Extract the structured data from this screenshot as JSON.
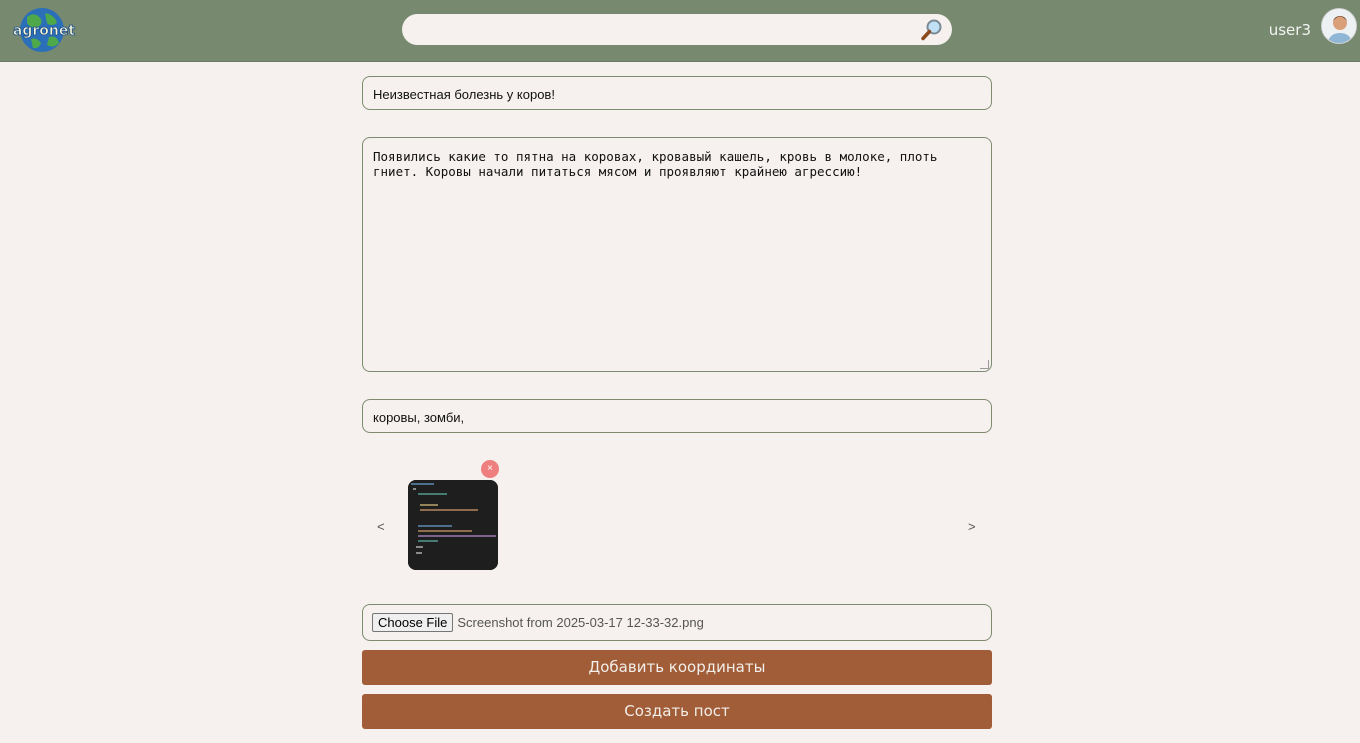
{
  "header": {
    "logo_text": "agronet",
    "search_placeholder": "",
    "username": "user3"
  },
  "form": {
    "title_value": "Неизвестная болезнь у коров!",
    "body_value": "Появились какие то пятна на коровах, кровавый кашель, кровь в молоке, плоть\nгниет. Коровы начали питаться мясом и проявляют крайнею агрессию!",
    "tags_value": "коровы, зомби,",
    "carousel": {
      "prev": "<",
      "next": ">",
      "remove": "×"
    },
    "file": {
      "button_label": "Choose File",
      "file_name": "Screenshot from 2025-03-17 12-33-32.png"
    },
    "add_coords_label": "Добавить координаты",
    "create_post_label": "Создать пост"
  },
  "colors": {
    "header_bg": "#778a6f",
    "page_bg": "#f6f1ee",
    "button_bg": "#a15c38",
    "remove_bg": "#ef7f7f"
  }
}
